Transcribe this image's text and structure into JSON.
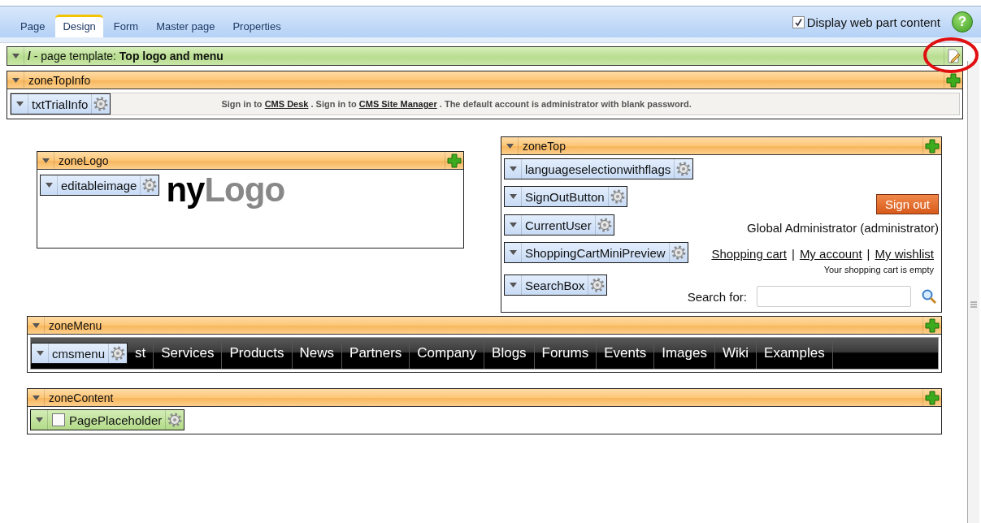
{
  "tabs": [
    {
      "label": "Page",
      "selected": false
    },
    {
      "label": "Design",
      "selected": true
    },
    {
      "label": "Form",
      "selected": false
    },
    {
      "label": "Master page",
      "selected": false
    },
    {
      "label": "Properties",
      "selected": false
    }
  ],
  "display_option": {
    "label": "Display web part content",
    "checked": true
  },
  "help": {
    "glyph": "?"
  },
  "template_bar": {
    "text": "**/** - page template: **Top logo and menu**"
  },
  "zone_top_info": {
    "title": "zoneTopInfo",
    "webpart": {
      "name": "txtTrialInfo",
      "kind": "webpart"
    },
    "segments": [
      {
        "text": "Sign in to",
        "kind": "text"
      },
      {
        "text": "CMS Desk",
        "kind": "link"
      },
      {
        "text": ". Sign in to",
        "kind": "text"
      },
      {
        "text": "CMS Site Manager",
        "kind": "link"
      },
      {
        "text": ". The default account is administrator with blank password.",
        "kind": "text"
      }
    ]
  },
  "zone_logo": {
    "title": "zoneLogo",
    "webpart": {
      "name": "editableimage",
      "kind": "webpart"
    },
    "logo": {
      "dark": "ny",
      "light": "Logo"
    }
  },
  "zone_top": {
    "title": "zoneTop",
    "rows": [
      {
        "webpart": {
          "name": "languageselectionwithflags",
          "kind": "webpart"
        },
        "kind": "empty"
      },
      {
        "webpart": {
          "name": "SignOutButton",
          "kind": "webpart"
        },
        "kind": "button",
        "label": "Sign out"
      },
      {
        "webpart": {
          "name": "CurrentUser",
          "kind": "webpart"
        },
        "kind": "text",
        "text": "Global Administrator (administrator)"
      },
      {
        "webpart": {
          "name": "ShoppingCartMiniPreview",
          "kind": "webpart"
        },
        "kind": "links",
        "items": [
          {
            "kind": "link",
            "text": "Shopping cart"
          },
          {
            "kind": "separator",
            "text": "|"
          },
          {
            "kind": "link",
            "text": "My account"
          },
          {
            "kind": "separator",
            "text": "|"
          },
          {
            "kind": "link",
            "text": "My wishlist"
          }
        ],
        "note": "Your shopping cart is empty"
      },
      {
        "webpart": {
          "name": "SearchBox",
          "kind": "webpart"
        },
        "kind": "search",
        "label": "Search for:"
      }
    ]
  },
  "zone_menu": {
    "title": "zoneMenu",
    "webpart": {
      "name": "cmsmenu",
      "kind": "webpart"
    },
    "items": [
      "st",
      "Services",
      "Products",
      "News",
      "Partners",
      "Company",
      "Blogs",
      "Forums",
      "Events",
      "Images",
      "Wiki",
      "Examples"
    ]
  },
  "zone_content": {
    "title": "zoneContent",
    "webpart": {
      "name": "PagePlaceholder",
      "kind": "placeholder"
    }
  }
}
